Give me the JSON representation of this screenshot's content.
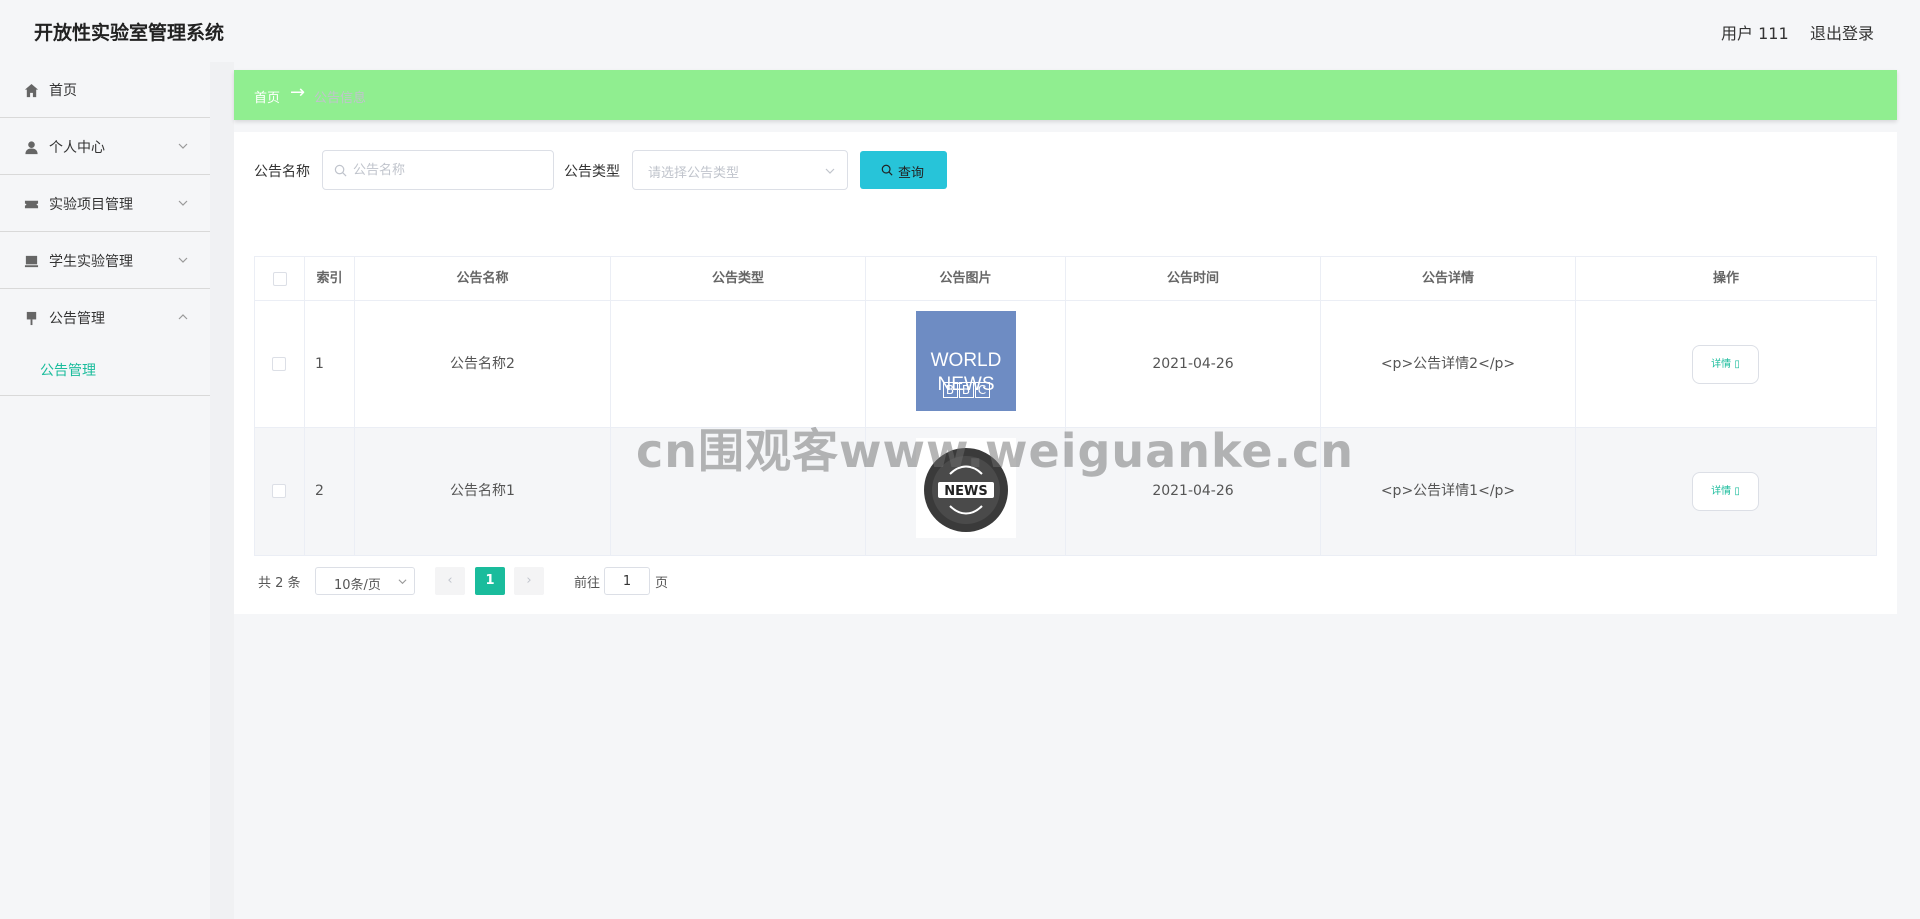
{
  "header": {
    "app_title": "开放性实验室管理系统",
    "user_label": "用户 111",
    "logout_label": "退出登录"
  },
  "sidebar": {
    "items": [
      {
        "label": "首页",
        "icon": "home-icon"
      },
      {
        "label": "个人中心",
        "icon": "user-icon"
      },
      {
        "label": "实验项目管理",
        "icon": "ticket-icon"
      },
      {
        "label": "学生实验管理",
        "icon": "box-icon"
      },
      {
        "label": "公告管理",
        "icon": "pin-icon"
      }
    ],
    "submenu_label": "公告管理"
  },
  "breadcrumb": {
    "home": "首页",
    "current": "公告信息"
  },
  "search": {
    "name_label": "公告名称",
    "name_placeholder": "公告名称",
    "type_label": "公告类型",
    "type_placeholder": "请选择公告类型",
    "button_label": "查询"
  },
  "table": {
    "headers": [
      "索引",
      "公告名称",
      "公告类型",
      "公告图片",
      "公告时间",
      "公告详情",
      "操作"
    ],
    "rows": [
      {
        "index": "1",
        "name": "公告名称2",
        "type": "",
        "image": "BBC WORLD NEWS",
        "time": "2021-04-26",
        "detail": "<p>公告详情2</p>",
        "action": "详情"
      },
      {
        "index": "2",
        "name": "公告名称1",
        "type": "",
        "image": "NEWS",
        "time": "2021-04-26",
        "detail": "<p>公告详情1</p>",
        "action": "详情"
      }
    ]
  },
  "pagination": {
    "total": "共 2 条",
    "page_size": "10条/页",
    "current_page": "1",
    "goto_label": "前往",
    "goto_value": "1",
    "page_unit": "页"
  },
  "watermark": "cn围观客www.weiguanke.cn",
  "colors": {
    "accent": "#1abc9c",
    "breadcrumb_bg": "#90ee90",
    "search_button": "#27c4d9"
  }
}
